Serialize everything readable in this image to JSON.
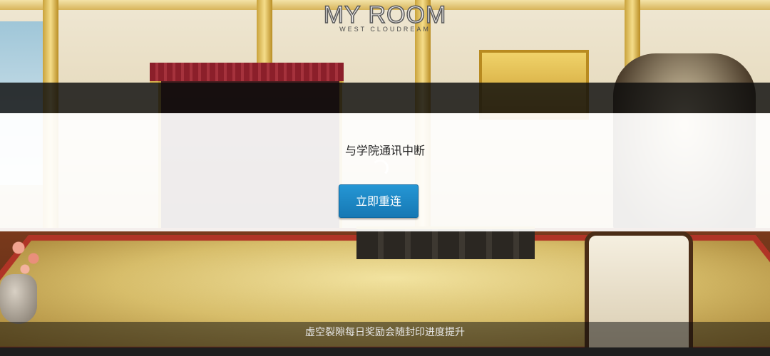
{
  "logo": {
    "title": "MY ROOM",
    "subtitle": "WEST CLOUDREAM"
  },
  "dialog": {
    "message": "与学院通讯中断",
    "reconnect_label": "立即重连",
    "button_color": "#1f8ccc"
  },
  "tip": {
    "text": "虚空裂隙每日奖励会随封印进度提升"
  },
  "loading": {
    "progress": 0
  }
}
